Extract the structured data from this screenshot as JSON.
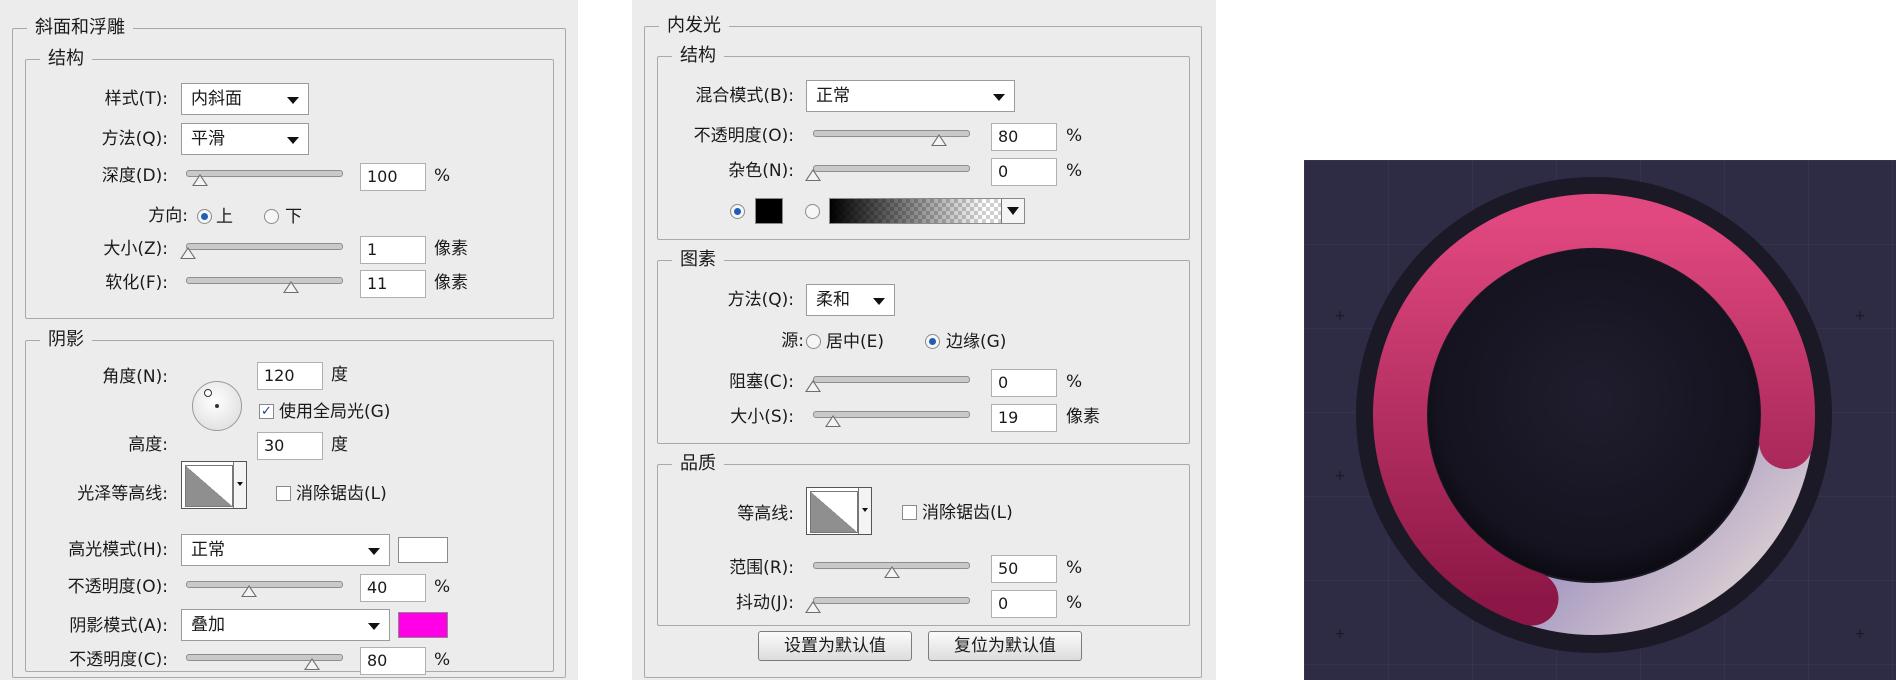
{
  "bevel": {
    "title": "斜面和浮雕",
    "structure": {
      "title": "结构",
      "style_label": "样式(T):",
      "style_value": "内斜面",
      "technique_label": "方法(Q):",
      "technique_value": "平滑",
      "depth_label": "深度(D):",
      "depth_value": "100",
      "depth_unit": "%",
      "depth_pos": 0.09,
      "direction_label": "方向:",
      "direction_up": "上",
      "direction_down": "下",
      "size_label": "大小(Z):",
      "size_value": "1",
      "size_unit": "像素",
      "size_pos": 0.01,
      "soften_label": "软化(F):",
      "soften_value": "11",
      "soften_unit": "像素",
      "soften_pos": 0.67
    },
    "shading": {
      "title": "阴影",
      "angle_label": "角度(N):",
      "angle_value": "120",
      "angle_unit": "度",
      "global_light_label": "使用全局光(G)",
      "altitude_label": "高度:",
      "altitude_value": "30",
      "altitude_unit": "度",
      "gloss_label": "光泽等高线:",
      "anti_alias_label": "消除锯齿(L)",
      "highlight_mode_label": "高光模式(H):",
      "highlight_mode_value": "正常",
      "highlight_color": "#ffffff",
      "highlight_opacity_label": "不透明度(O):",
      "highlight_opacity_value": "40",
      "highlight_opacity_unit": "%",
      "highlight_opacity_pos": 0.4,
      "shadow_mode_label": "阴影模式(A):",
      "shadow_mode_value": "叠加",
      "shadow_color": "#ff00e6",
      "shadow_opacity_label": "不透明度(C):",
      "shadow_opacity_value": "80",
      "shadow_opacity_unit": "%",
      "shadow_opacity_pos": 0.8
    }
  },
  "inner_glow": {
    "title": "内发光",
    "structure": {
      "title": "结构",
      "blend_label": "混合模式(B):",
      "blend_value": "正常",
      "opacity_label": "不透明度(O):",
      "opacity_value": "80",
      "opacity_unit": "%",
      "opacity_pos": 0.8,
      "noise_label": "杂色(N):",
      "noise_value": "0",
      "noise_unit": "%",
      "noise_pos": 0.0,
      "glow_color": "#000000"
    },
    "elements": {
      "title": "图素",
      "technique_label": "方法(Q):",
      "technique_value": "柔和",
      "source_label": "源:",
      "source_center": "居中(E)",
      "source_edge": "边缘(G)",
      "choke_label": "阻塞(C):",
      "choke_value": "0",
      "choke_unit": "%",
      "choke_pos": 0.0,
      "size_label": "大小(S):",
      "size_value": "19",
      "size_unit": "像素",
      "size_pos": 0.13
    },
    "quality": {
      "title": "品质",
      "contour_label": "等高线:",
      "anti_alias_label": "消除锯齿(L)",
      "range_label": "范围(R):",
      "range_value": "50",
      "range_unit": "%",
      "range_pos": 0.5,
      "jitter_label": "抖动(J):",
      "jitter_value": "0",
      "jitter_unit": "%",
      "jitter_pos": 0.0
    },
    "buttons": {
      "make_default": "设置为默认值",
      "reset_default": "复位为默认值"
    }
  },
  "preview": {
    "progress": 0.72,
    "ring_color_start": "#e0487f",
    "ring_color_end": "#8c1746",
    "track_color": "#9d90bf",
    "background_color": "#2e2b45"
  }
}
